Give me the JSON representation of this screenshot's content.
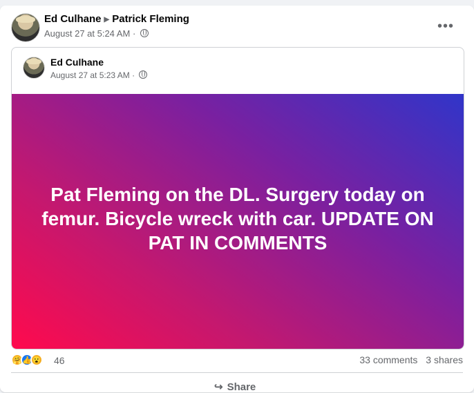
{
  "post": {
    "author": "Ed Culhane",
    "recipient": "Patrick Fleming",
    "timestamp": "August 27 at 5:24 AM",
    "more_icon": "more-options-icon"
  },
  "shared_post": {
    "author": "Ed Culhane",
    "timestamp": "August 27 at 5:23 AM",
    "text": "Pat Fleming on the DL. Surgery today on femur. Bicycle wreck with car. UPDATE ON PAT IN COMMENTS",
    "gradient_colors": [
      "#ff0a4d",
      "#7a20a0",
      "#3035c9"
    ]
  },
  "reactions": {
    "icons": [
      "care-icon",
      "like-icon",
      "wow-icon"
    ],
    "count": "46",
    "comments": "33 comments",
    "shares": "3 shares"
  },
  "actions": {
    "share_label": "Share"
  },
  "separator": "·",
  "colors": {
    "background": "#f0f2f5",
    "secondary_text": "#65676b",
    "like_blue": "#1877f2"
  }
}
